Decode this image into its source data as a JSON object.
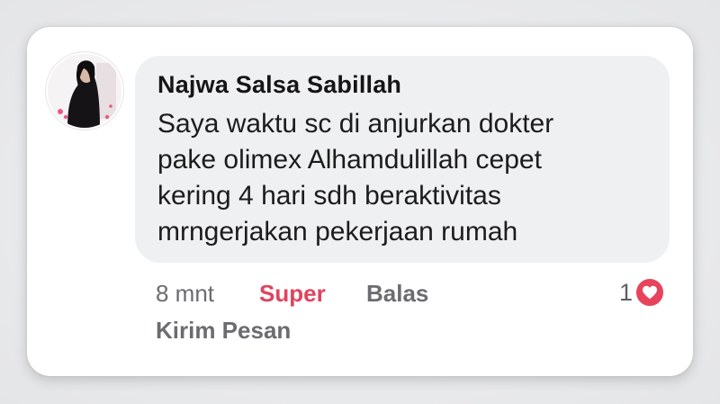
{
  "comment": {
    "author": "Najwa Salsa Sabillah",
    "lines": [
      "Saya waktu sc di anjurkan dokter",
      "pake olimex Alhamdulillah cepet",
      "kering 4 hari sdh beraktivitas",
      "mrngerjakan pekerjaan rumah"
    ],
    "time": "8 mnt",
    "react_label": "Super",
    "reply_label": "Balas",
    "reaction_count": "1",
    "reaction_icon": "heart-icon",
    "send_message_label": "Kirim Pesan"
  },
  "colors": {
    "react": "#e0435e",
    "heart": "#e8435c",
    "bubble": "#eff0f2"
  }
}
